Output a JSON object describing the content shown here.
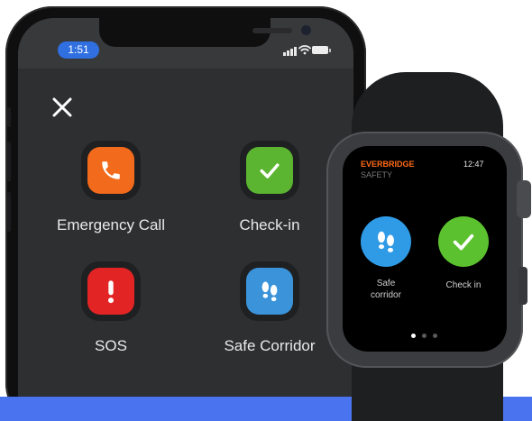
{
  "phone": {
    "status_time": "1:51",
    "actions": [
      {
        "label": "Emergency Call",
        "icon": "phone-icon",
        "color": "#f26a1b"
      },
      {
        "label": "Check-in",
        "icon": "check-icon",
        "color": "#5cb531"
      },
      {
        "label": "SOS",
        "icon": "exclamation-icon",
        "color": "#e32424"
      },
      {
        "label": "Safe Corridor",
        "icon": "footsteps-icon",
        "color": "#3b93d9"
      }
    ]
  },
  "watch": {
    "brand": "EVERBRIDGE",
    "subtitle": "SAFETY",
    "time": "12:47",
    "actions": [
      {
        "label_line1": "Safe",
        "label_line2": "corridor",
        "icon": "footsteps-icon",
        "color": "#2f9be6"
      },
      {
        "label": "Check in",
        "icon": "check-icon",
        "color": "#5cc12f"
      }
    ],
    "page_indicator": {
      "pages": 3,
      "active_index": 0
    }
  },
  "colors": {
    "accent_blue": "#4a73f0",
    "screen_bg": "#2d2f31"
  }
}
